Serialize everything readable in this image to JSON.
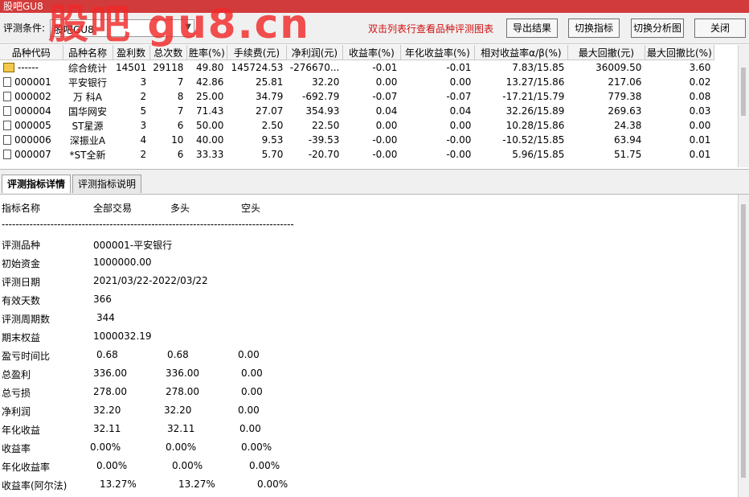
{
  "window": {
    "title": "股吧GU8"
  },
  "watermark": "股吧 gu8.cn",
  "toolbar": {
    "condition_label": "评测条件:",
    "condition_value": "股吧GU8",
    "hint": "双击列表行查看品种评测图表",
    "export_label": "导出结果",
    "switch_indicator_label": "切换指标",
    "switch_chart_label": "切换分析图",
    "close_label": "关闭"
  },
  "table": {
    "columns": [
      "品种代码",
      "品种名称",
      "盈利数",
      "总次数",
      "胜率(%)",
      "手续费(元)",
      "净利润(元)",
      "收益率(%)",
      "年化收益率(%)",
      "相对收益率α/β(%)",
      "最大回撤(元)",
      "最大回撤比(%)"
    ],
    "rows": [
      [
        "------",
        "综合统计",
        "14501",
        "29118",
        "49.80",
        "145724.53",
        "-276670...",
        "-0.01",
        "-0.01",
        "7.83/15.85",
        "36009.50",
        "3.60"
      ],
      [
        "000001",
        "平安银行",
        "3",
        "7",
        "42.86",
        "25.81",
        "32.20",
        "0.00",
        "0.00",
        "13.27/15.86",
        "217.06",
        "0.02"
      ],
      [
        "000002",
        "万 科A",
        "2",
        "8",
        "25.00",
        "34.79",
        "-692.79",
        "-0.07",
        "-0.07",
        "-17.21/15.79",
        "779.38",
        "0.08"
      ],
      [
        "000004",
        "国华网安",
        "5",
        "7",
        "71.43",
        "27.07",
        "354.93",
        "0.04",
        "0.04",
        "32.26/15.89",
        "269.63",
        "0.03"
      ],
      [
        "000005",
        "ST星源",
        "3",
        "6",
        "50.00",
        "2.50",
        "22.50",
        "0.00",
        "0.00",
        "10.28/15.86",
        "24.38",
        "0.00"
      ],
      [
        "000006",
        "深振业A",
        "4",
        "10",
        "40.00",
        "9.53",
        "-39.53",
        "-0.00",
        "-0.00",
        "-10.52/15.85",
        "63.94",
        "0.01"
      ],
      [
        "000007",
        "*ST全新",
        "2",
        "6",
        "33.33",
        "5.70",
        "-20.70",
        "-0.00",
        "-0.00",
        "5.96/15.85",
        "51.75",
        "0.01"
      ]
    ]
  },
  "tabs": [
    "评测指标详情",
    "评测指标说明"
  ],
  "detail": {
    "header": [
      "指标名称",
      "全部交易",
      "多头",
      "空头"
    ],
    "separator": "------------------------------------------------------------------------------------",
    "info": [
      [
        "评测品种",
        "000001-平安银行"
      ],
      [
        "初始资金",
        "1000000.00"
      ],
      [
        "评测日期",
        "2021/03/22-2022/03/22"
      ],
      [
        "有效天数",
        "366"
      ],
      [
        "评测周期数",
        "344"
      ],
      [
        "期末权益",
        "1000032.19"
      ]
    ],
    "metrics": [
      [
        "盈亏时间比",
        "0.68",
        "0.68",
        "0.00"
      ],
      [
        "总盈利",
        "336.00",
        "336.00",
        "0.00"
      ],
      [
        "总亏损",
        "278.00",
        "278.00",
        "0.00"
      ],
      [
        "净利润",
        "32.20",
        "32.20",
        "0.00"
      ],
      [
        "年化收益",
        "32.11",
        "32.11",
        "0.00"
      ],
      [
        "收益率",
        "0.00%",
        "0.00%",
        "0.00%"
      ],
      [
        "年化收益率",
        "0.00%",
        "0.00%",
        "0.00%"
      ],
      [
        "收益率(阿尔法)",
        "13.27%",
        "13.27%",
        "0.00%"
      ]
    ]
  }
}
